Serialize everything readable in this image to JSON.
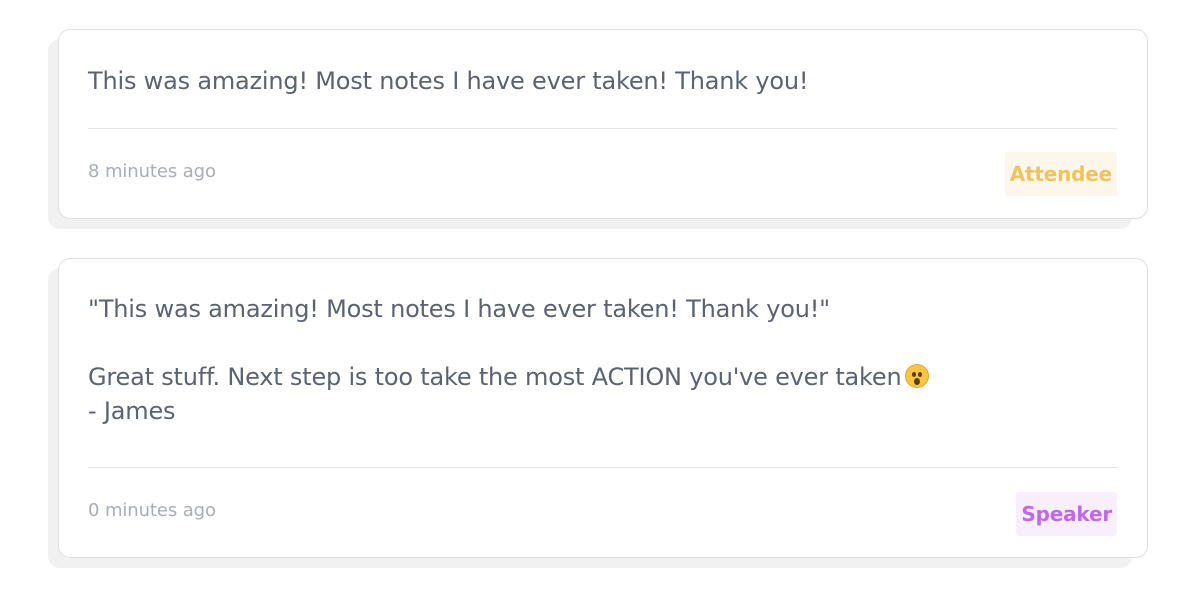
{
  "comments": [
    {
      "lines": [
        "This was amazing! Most notes I have ever taken! Thank you!"
      ],
      "timestamp": "8 minutes ago",
      "role": "Attendee"
    },
    {
      "quote": "\"This was amazing! Most notes I have ever taken! Thank you!\"",
      "reply_line": "Great stuff. Next step is too take the most ACTION you've ever taken",
      "reply_icon": "astonished-face-icon",
      "signature": "- James",
      "timestamp": "0 minutes ago",
      "role": "Speaker"
    }
  ],
  "colors": {
    "attendee_badge_text": "#f0c35f",
    "attendee_badge_bg": "#fdf6ea",
    "speaker_badge_text": "#c168e8",
    "speaker_badge_bg": "#f9eefc",
    "body_text": "#5b6270",
    "muted_text": "#a9adb5"
  }
}
